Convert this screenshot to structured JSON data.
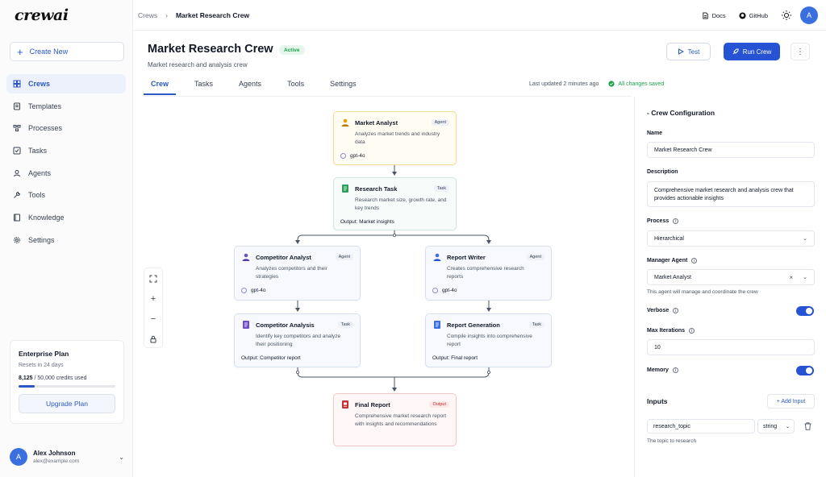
{
  "app": {
    "logo": "crewai"
  },
  "sidebar": {
    "create_label": "Create New",
    "items": [
      {
        "label": "Crews",
        "icon": "layers-icon",
        "active": true
      },
      {
        "label": "Templates",
        "icon": "template-icon"
      },
      {
        "label": "Processes",
        "icon": "process-icon"
      },
      {
        "label": "Tasks",
        "icon": "checkbox-icon"
      },
      {
        "label": "Agents",
        "icon": "agent-icon"
      },
      {
        "label": "Tools",
        "icon": "wrench-icon"
      },
      {
        "label": "Knowledge",
        "icon": "book-icon"
      },
      {
        "label": "Settings",
        "icon": "gear-icon"
      }
    ],
    "plan": {
      "title": "Enterprise Plan",
      "reset": "Resets in 24 days",
      "credits_used": "8,125",
      "credits_total": " / 50,000 credits used",
      "usage_fraction": 0.1625,
      "upgrade_label": "Upgrade Plan"
    },
    "user": {
      "initial": "A",
      "name": "Alex Johnson",
      "email": "alex@example.com"
    }
  },
  "topbar": {
    "breadcrumb": [
      "Crews",
      "Market Research Crew"
    ],
    "docs_label": "Docs",
    "github_label": "GitHub",
    "avatar_initial": "A"
  },
  "header": {
    "title": "Market Research Crew",
    "status": "Active",
    "subtitle": "Market research and analysis crew",
    "test_label": "Test",
    "run_label": "Run Crew",
    "more_label": "⋮"
  },
  "tabs": [
    "Crew",
    "Tasks",
    "Agents",
    "Tools",
    "Settings"
  ],
  "meta": {
    "updated": "Last updated 2 minutes ago",
    "saved": "All changes saved"
  },
  "nodes": {
    "market_analyst": {
      "title": "Market Analyst",
      "tag": "Agent",
      "desc": "Analyzes market trends and industry data",
      "model": "gpt-4o"
    },
    "research_task": {
      "title": "Research Task",
      "tag": "Task",
      "desc": "Research market size, growth rate, and key trends",
      "output": "Output: Market insights"
    },
    "competitor_analyst": {
      "title": "Competitor Analyst",
      "tag": "Agent",
      "desc": "Analyzes competitors and their strategies",
      "model": "gpt-4o"
    },
    "report_writer": {
      "title": "Report Writer",
      "tag": "Agent",
      "desc": "Creates comprehensive research reports",
      "model": "gpt-4o"
    },
    "competitor_analysis": {
      "title": "Competitor Analysis",
      "tag": "Task",
      "desc": "Identify key competitors and analyze their positioning",
      "output": "Output: Competitor report"
    },
    "report_generation": {
      "title": "Report Generation",
      "tag": "Task",
      "desc": "Compile insights into comprehensive report",
      "output": "Output: Final report"
    },
    "final_report": {
      "title": "Final Report",
      "tag": "Output",
      "desc": "Comprehensive market research report with insights and recommendations"
    }
  },
  "config": {
    "title": "- Crew Configuration",
    "name_label": "Name",
    "name_value": "Market Research Crew",
    "desc_label": "Description",
    "desc_value": "Comprehensive market research and analysis crew that provides actionable insights",
    "process_label": "Process",
    "process_value": "Hierarchical",
    "manager_label": "Manager Agent",
    "manager_value": "Market Analyst",
    "manager_hint": "This agent will manage and coordinate the crew",
    "verbose_label": "Verbose",
    "verbose_on": true,
    "max_iter_label": "Max Iterations",
    "max_iter_value": "10",
    "memory_label": "Memory",
    "memory_on": true,
    "inputs_title": "Inputs",
    "add_input_label": "+ Add Input",
    "input_var": "research_topic",
    "input_type": "string",
    "input_hint": "The topic to research"
  },
  "colors": {
    "accent": "#2553d4",
    "active_green": "#16a34a",
    "output_red": "#c53030"
  }
}
